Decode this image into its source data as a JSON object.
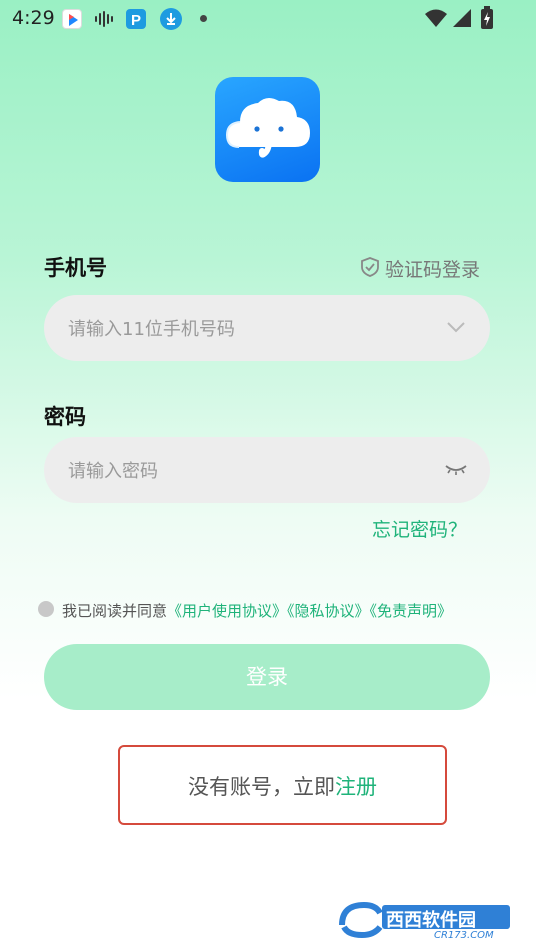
{
  "status_bar": {
    "time": "4:29",
    "icons": [
      "video-app-icon",
      "waveform-icon",
      "parking-app-icon",
      "download-icon",
      "notification-dot",
      "wifi-icon",
      "signal-icon",
      "battery-charging-icon"
    ]
  },
  "app": {
    "logo": "cloud-elephant-logo"
  },
  "phone": {
    "label": "手机号",
    "sms_login": "验证码登录",
    "placeholder": "请输入11位手机号码"
  },
  "password": {
    "label": "密码",
    "placeholder": "请输入密码",
    "forgot": "忘记密码？"
  },
  "agreement": {
    "prefix": "我已阅读并同意",
    "links": [
      "《用户使用协议》",
      "《隐私协议》",
      "《免责声明》"
    ]
  },
  "login_button": "登录",
  "register": {
    "prefix": "没有账号，立即",
    "link": "注册"
  },
  "watermark": {
    "text": "西西软件园",
    "sub": "CR173.COM"
  },
  "colors": {
    "accent": "#1fb37a",
    "button_disabled": "#a7edc9",
    "highlight_box": "#d54a3c"
  }
}
